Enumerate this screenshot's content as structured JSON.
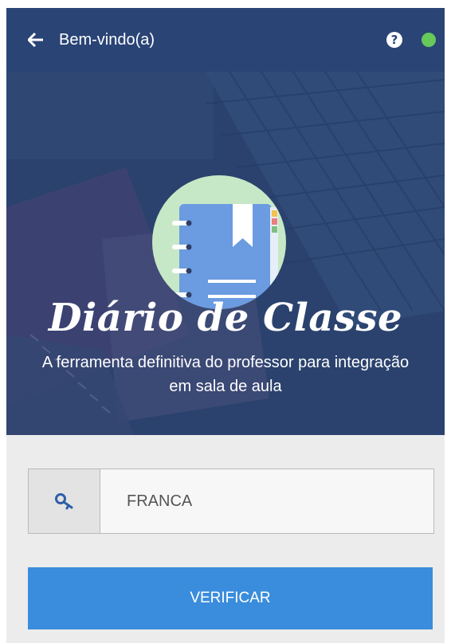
{
  "appbar": {
    "title": "Bem-vindo(a)",
    "help_glyph": "?",
    "back_icon": "arrow-left-icon",
    "status_color": "#66c95a"
  },
  "hero": {
    "app_name": "Diário de Classe",
    "tagline": "A ferramenta definitiva do professor para integração em sala de aula",
    "logo_icon": "notebook-icon"
  },
  "form": {
    "code_value": "FRANCA",
    "key_icon": "key-icon",
    "verify_label": "VERIFICAR"
  },
  "colors": {
    "appbar": "#2a4476",
    "accent": "#3a8ddc",
    "background": "#ececec"
  }
}
